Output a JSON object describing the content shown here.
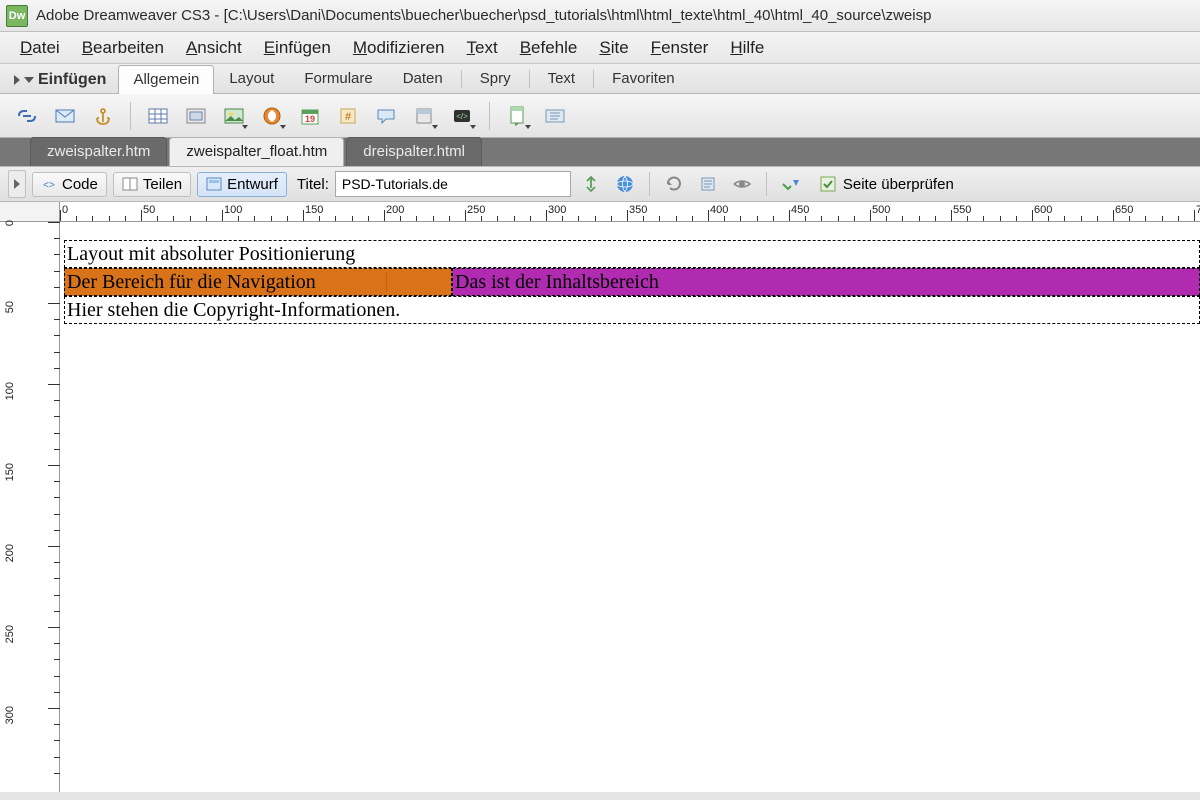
{
  "titlebar": {
    "app_icon": "Dw",
    "text": "Adobe Dreamweaver CS3 - [C:\\Users\\Dani\\Documents\\buecher\\buecher\\psd_tutorials\\html\\html_texte\\html_40\\html_40_source\\zweisp"
  },
  "menu": {
    "items": [
      {
        "ul": "D",
        "rest": "atei"
      },
      {
        "ul": "B",
        "rest": "earbeiten"
      },
      {
        "ul": "A",
        "rest": "nsicht"
      },
      {
        "ul": "E",
        "rest": "infügen"
      },
      {
        "ul": "M",
        "rest": "odifizieren"
      },
      {
        "ul": "T",
        "rest": "ext"
      },
      {
        "ul": "B",
        "rest": "efehle"
      },
      {
        "ul": "S",
        "rest": "ite"
      },
      {
        "ul": "F",
        "rest": "enster"
      },
      {
        "ul": "H",
        "rest": "ilfe"
      }
    ]
  },
  "insertbar": {
    "label": "Einfügen",
    "tabs": [
      "Allgemein",
      "Layout",
      "Formulare",
      "Daten",
      "Spry",
      "Text",
      "Favoriten"
    ],
    "active": 0
  },
  "doctabs": {
    "tabs": [
      "zweispalter.htm",
      "zweispalter_float.htm",
      "dreispalter.html"
    ],
    "active": 1
  },
  "docbar": {
    "code": "Code",
    "split": "Teilen",
    "design": "Entwurf",
    "title_label": "Titel:",
    "title_value": "PSD-Tutorials.de",
    "check": "Seite überprüfen"
  },
  "ruler": {
    "h_start": 0,
    "h_step": 50,
    "h_count": 15,
    "v_marks": [
      "0",
      "50",
      "100",
      "150",
      "200",
      "250",
      "300"
    ]
  },
  "canvas": {
    "header": "Layout mit absoluter Positionierung",
    "nav": "Der Bereich für die Navigation",
    "content": "Das ist der Inhaltsbereich",
    "footer": "Hier stehen die Copyright-Informationen."
  }
}
